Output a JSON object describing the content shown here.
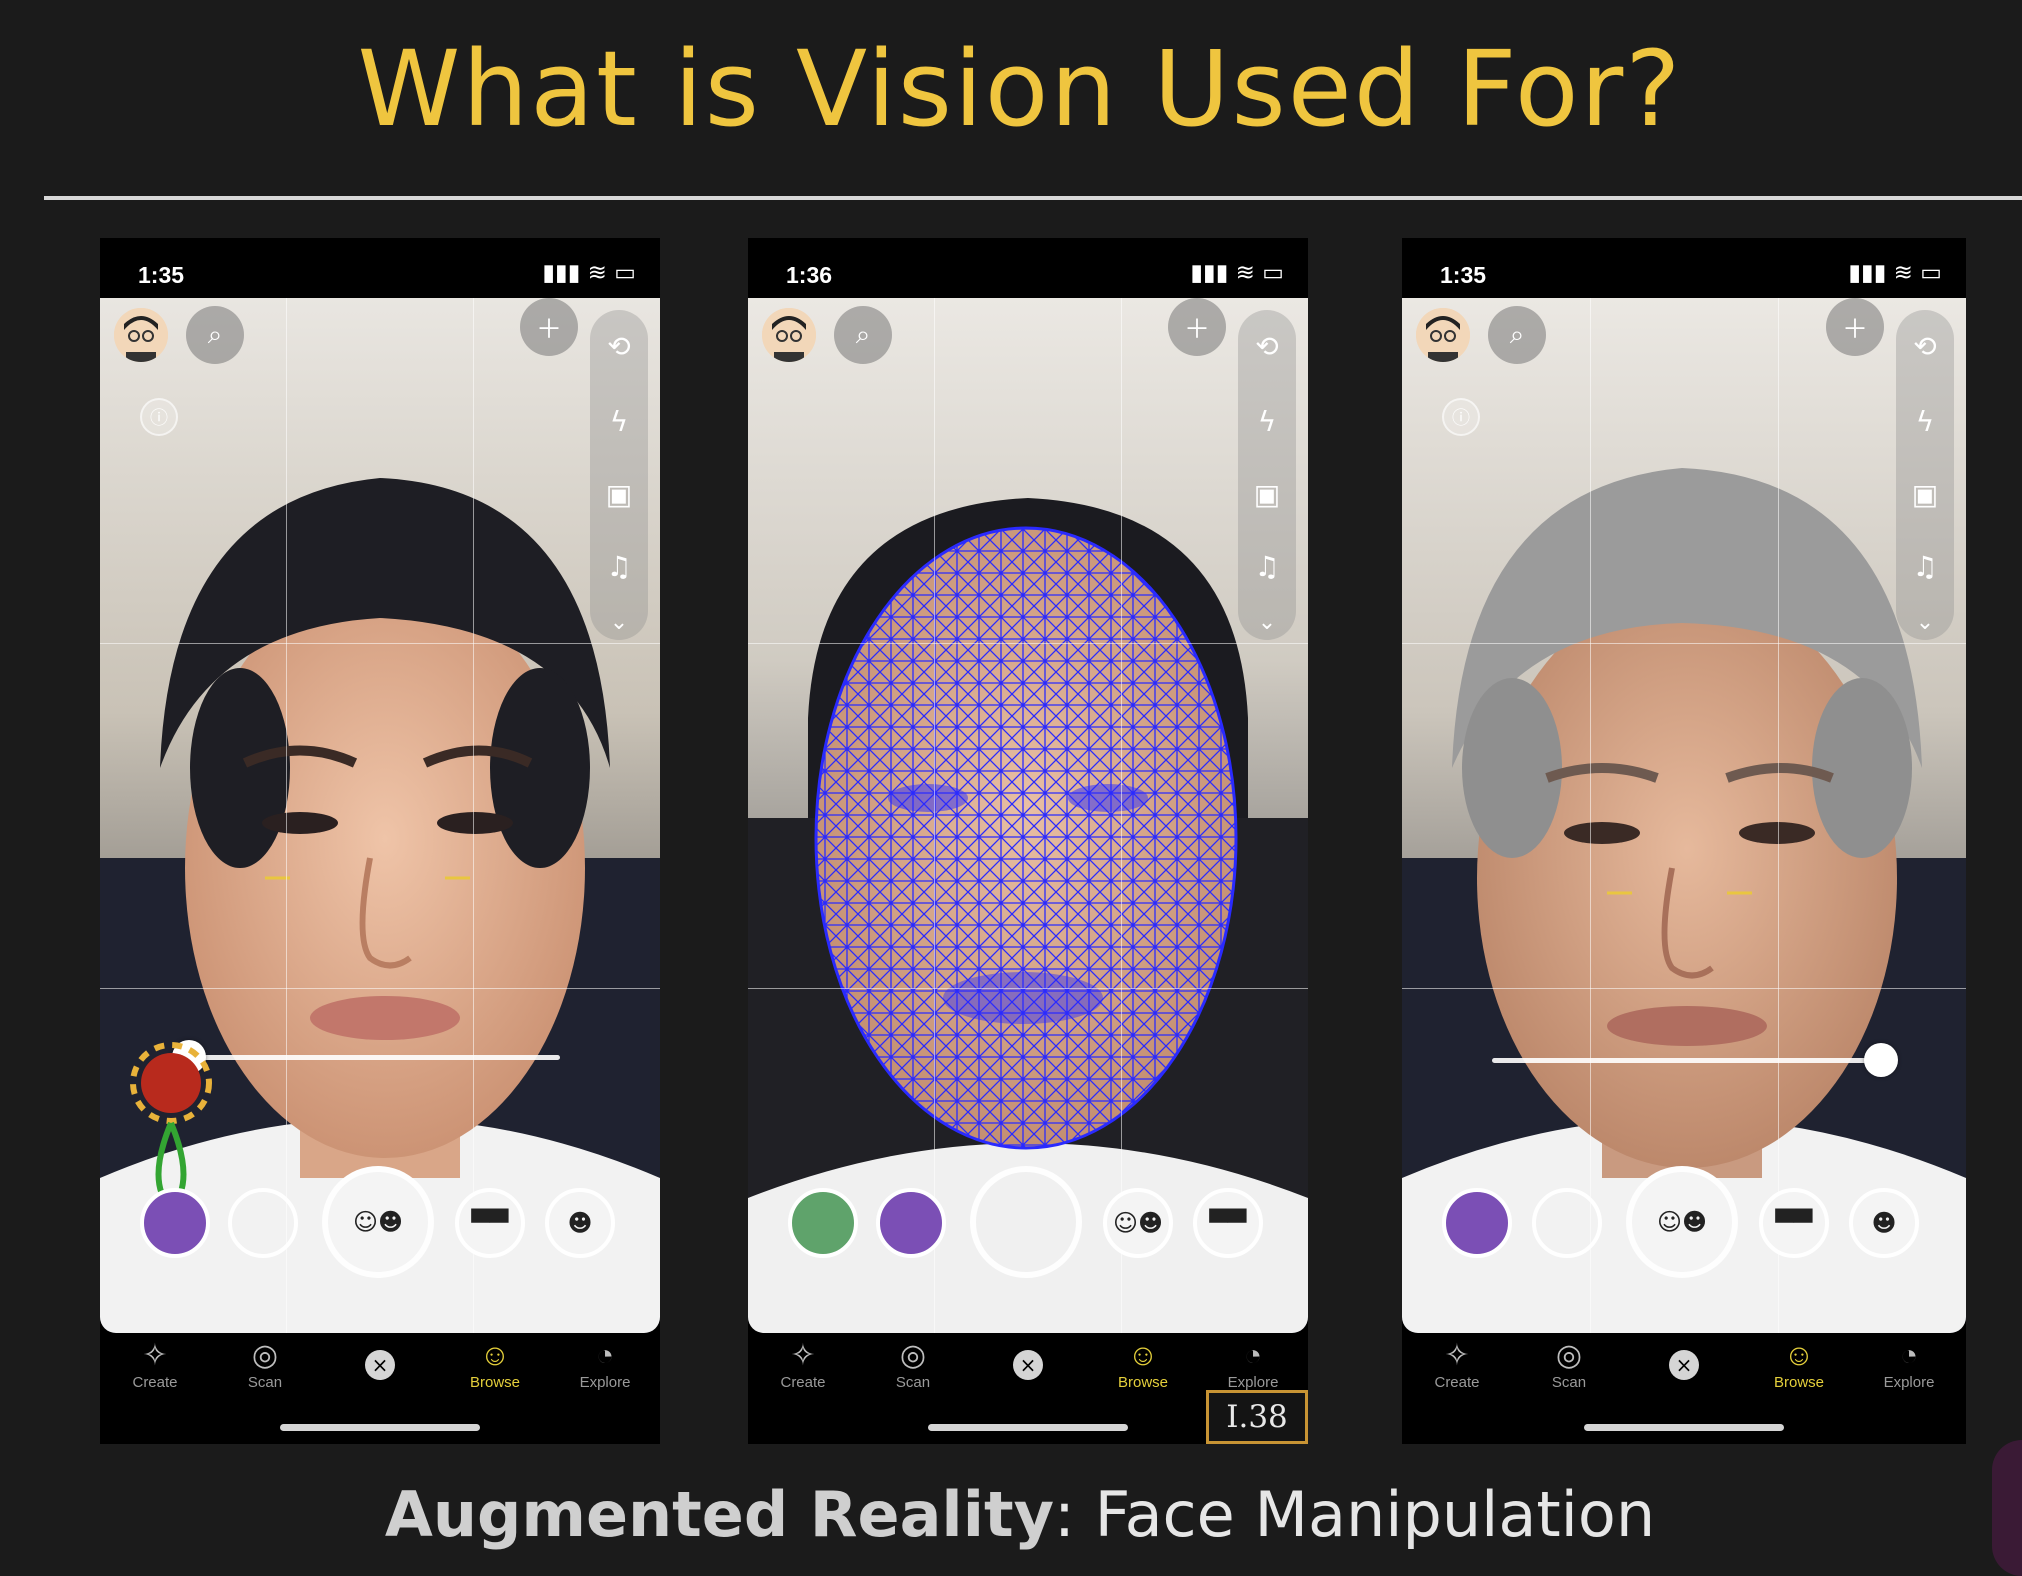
{
  "slide": {
    "title": "What is Vision Used For?",
    "caption_bold": "Augmented Reality",
    "caption_rest": ": Face Manipulation",
    "slide_number": "I.38"
  },
  "phones": [
    {
      "time": "1:35",
      "status_icons": "▮▮▮ ≋ ▭",
      "variant": "young",
      "slider_value": 0.0,
      "nav": {
        "create": "Create",
        "scan": "Scan",
        "browse": "Browse",
        "explore": "Explore"
      }
    },
    {
      "time": "1:36",
      "status_icons": "▮▮▮ ≋ ▭",
      "variant": "mesh",
      "nav": {
        "create": "Create",
        "scan": "Scan",
        "browse": "Browse",
        "explore": "Explore"
      }
    },
    {
      "time": "1:35",
      "status_icons": "▮▮▮ ≋ ▭",
      "variant": "old",
      "slider_value": 1.0,
      "nav": {
        "create": "Create",
        "scan": "Scan",
        "browse": "Browse",
        "explore": "Explore"
      }
    }
  ],
  "colors": {
    "title": "#efc53f",
    "mesh": "#2a2aff",
    "active_nav": "#e4cf3b"
  },
  "icons": [
    "search-icon",
    "add-friend-icon",
    "flip-camera-icon",
    "flash-off-icon",
    "video-icon",
    "music-icon",
    "chevron-down-icon",
    "info-icon",
    "create-icon",
    "scan-icon",
    "close-icon",
    "browse-icon",
    "explore-icon"
  ]
}
